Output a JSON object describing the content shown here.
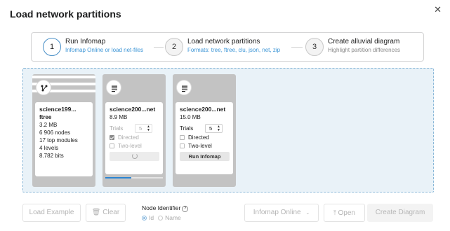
{
  "dialog": {
    "title": "Load network partitions",
    "close_glyph": "✕"
  },
  "steps": [
    {
      "number": "1",
      "title": "Run Infomap",
      "subtitle": "Infomap Online or load net-files",
      "active": true
    },
    {
      "number": "2",
      "title": "Load network partitions",
      "subtitle": "Formats: tree, ftree, clu, json, net, zip",
      "active": false
    },
    {
      "number": "3",
      "title": "Create alluvial diagram",
      "subtitle": "Highlight partition differences",
      "active": false
    }
  ],
  "cards": [
    {
      "icon": "network-icon",
      "filename": "science199...",
      "format": "ftree",
      "size": "3.2 MB",
      "stats": [
        "6 906 nodes",
        "17 top modules",
        "4 levels",
        "8.782 bits"
      ]
    },
    {
      "icon": "document-lines-icon",
      "filename": "science200...net",
      "size": "8.9 MB",
      "trials_label": "Trials",
      "trials_value": "5",
      "directed_label": "Directed",
      "directed_checked": true,
      "twolevel_label": "Two-level",
      "twolevel_checked": false,
      "state": "running",
      "progress": 0.45
    },
    {
      "icon": "document-lines-icon",
      "filename": "science200...net",
      "size": "15.0 MB",
      "trials_label": "Trials",
      "trials_value": "5",
      "directed_label": "Directed",
      "directed_checked": false,
      "twolevel_label": "Two-level",
      "twolevel_checked": false,
      "run_label": "Run Infomap"
    }
  ],
  "footer": {
    "load_example": "Load Example",
    "clear": "Clear",
    "node_identifier_label": "Node Identifier",
    "radio_id": "Id",
    "radio_name": "Name",
    "infomap_online": "Infomap Online",
    "open": "Open",
    "create_diagram": "Create Diagram"
  },
  "colors": {
    "accent": "#3c95d6",
    "dropzone_bg": "#e9f2f8",
    "card_bg": "#c3c3c3",
    "progress": "#2a84d2"
  }
}
